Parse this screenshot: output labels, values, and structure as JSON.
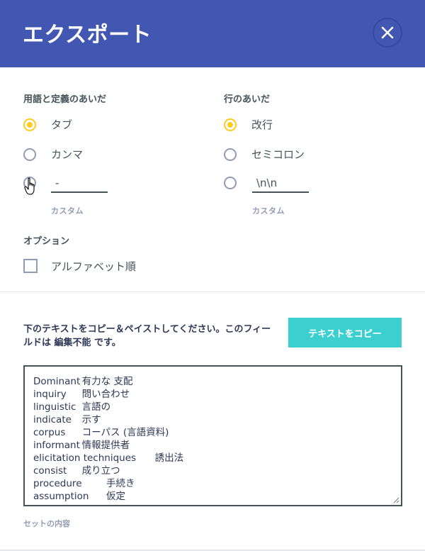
{
  "header": {
    "title": "エクスポート",
    "close_icon": "close-icon"
  },
  "term_separator": {
    "label": "用語と定義のあいだ",
    "options": [
      {
        "label": "タブ",
        "checked": true
      },
      {
        "label": "カンマ",
        "checked": false
      }
    ],
    "custom_value": "-",
    "custom_caption": "カスタム"
  },
  "row_separator": {
    "label": "行のあいだ",
    "options": [
      {
        "label": "改行",
        "checked": true
      },
      {
        "label": "セミコロン",
        "checked": false
      }
    ],
    "custom_value": "\\n\\n",
    "custom_caption": "カスタム"
  },
  "options": {
    "label": "オプション",
    "alphabetical": {
      "label": "アルファベット順",
      "checked": false
    }
  },
  "copy_section": {
    "instructions": "下のテキストをコピー＆ペイストしてください。このフィールドは 編集不能 です。",
    "copy_button_label": "テキストをコピー"
  },
  "export_text": [
    {
      "term": "Dominant",
      "definition": "有力な 支配"
    },
    {
      "term": "inquiry",
      "definition": "問い合わせ"
    },
    {
      "term": "linguistic",
      "definition": "言語の"
    },
    {
      "term": "indicate",
      "definition": "示す"
    },
    {
      "term": "corpus",
      "definition": "コーパス (言語資料)"
    },
    {
      "term": "informant",
      "definition": "情報提供者"
    },
    {
      "term": "elicitation techniques",
      "definition": "誘出法"
    },
    {
      "term": "consist",
      "definition": "成り立つ"
    },
    {
      "term": "procedure",
      "definition": "手続き"
    },
    {
      "term": "assumption",
      "definition": "仮定"
    }
  ],
  "set_caption": "セットの内容",
  "colors": {
    "header_bg": "#4257b2",
    "accent_yellow": "#ffcd1f",
    "copy_button": "#3ccfcf"
  }
}
